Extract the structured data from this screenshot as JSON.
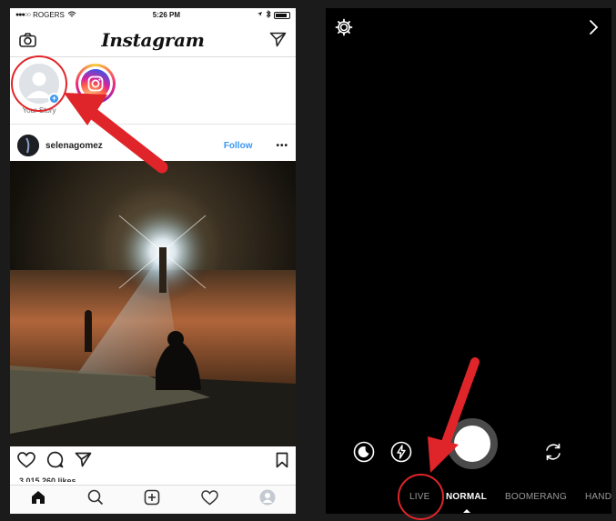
{
  "left_phone": {
    "status": {
      "carrier": "ROGERS",
      "time": "5:26 PM"
    },
    "app_title": "Instagram",
    "stories": [
      {
        "label": "Your Story"
      },
      {
        "label": ""
      }
    ],
    "post": {
      "username": "selenagomez",
      "follow_label": "Follow",
      "more_label": "•••",
      "likes": "3,015,260 likes"
    }
  },
  "right_phone": {
    "modes": [
      {
        "label": "LIVE",
        "active": false
      },
      {
        "label": "NORMAL",
        "active": true
      },
      {
        "label": "BOOMERANG",
        "active": false
      },
      {
        "label": "HAND",
        "active": false
      }
    ]
  },
  "colors": {
    "highlight_red": "#e0252a",
    "link_blue": "#3897f0",
    "camera_bg": "#000000"
  },
  "icons": [
    "camera-icon",
    "direct-icon",
    "heart-icon",
    "comment-icon",
    "share-icon",
    "bookmark-icon",
    "home-icon",
    "search-icon",
    "add-icon",
    "activity-icon",
    "profile-icon",
    "settings-icon",
    "chevron-right-icon",
    "night-mode-icon",
    "flash-icon",
    "flip-camera-icon"
  ]
}
